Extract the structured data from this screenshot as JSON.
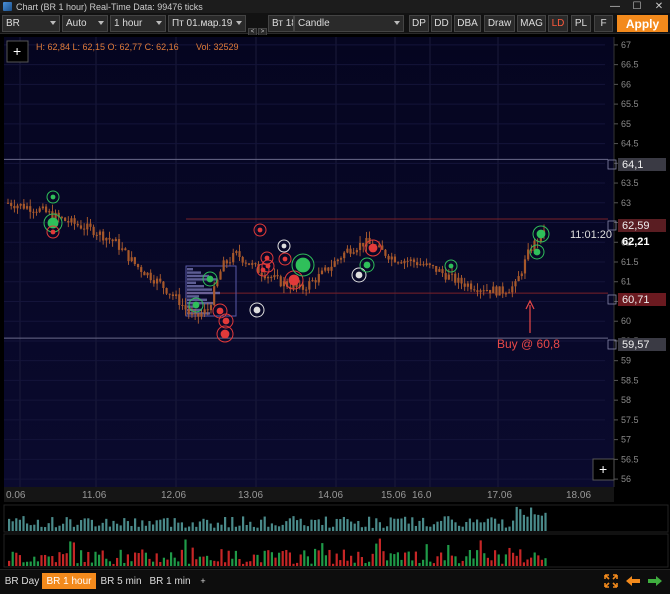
{
  "window": {
    "title": "Chart (BR 1 hour) Real-Time Data: 99476 ticks",
    "minimize": "—",
    "maximize": "☐",
    "close": "✕"
  },
  "toolbar": {
    "symbol": "BR",
    "scale": "Auto",
    "timeframe": "1 hour",
    "date_from": "Пт 01.мар.19",
    "date_to": "Вт 18",
    "chart_type": "Candle",
    "step_left": "<",
    "step_right": ">",
    "buttons": [
      "DP",
      "DD",
      "DBA",
      "Draw",
      "MAG",
      "LD",
      "PL",
      "F"
    ],
    "active_button": "LD",
    "apply_label": "Apply"
  },
  "info": {
    "ohlc": "H: 62,84  L: 62,15  O: 62,77  C: 62,16",
    "volume": "Vol: 32529",
    "zoom_in": "+"
  },
  "price_labels": {
    "level_high": "64,1",
    "last_price": "62,59",
    "countdown": "11:01:20",
    "bid": "62,21",
    "entry_level": "60,71",
    "level_low": "59,57"
  },
  "annotation": "Buy @ 60,8",
  "chart_data": {
    "type": "candlestick",
    "symbol": "BR",
    "timeframe": "1 hour",
    "y_ticks": [
      "67",
      "66.5",
      "66",
      "65.5",
      "65",
      "64.5",
      "64",
      "63.5",
      "63",
      "62.5",
      "62",
      "61.5",
      "61",
      "60.5",
      "60",
      "59.5",
      "59",
      "58.5",
      "58",
      "57.5",
      "57",
      "56.5",
      "56"
    ],
    "ylim": [
      55.8,
      67.2
    ],
    "x_ticks": [
      "0.06",
      "11.06",
      "12.06",
      "13.06",
      "14.06",
      "15.06",
      "16.0",
      "17.06",
      "18.06"
    ],
    "horizontal_levels": [
      64.1,
      62.59,
      60.71,
      59.57
    ],
    "close_path": [
      {
        "t": 0,
        "p": 63.0
      },
      {
        "t": 0.08,
        "p": 62.85
      },
      {
        "t": 0.16,
        "p": 62.55
      },
      {
        "t": 0.24,
        "p": 62.3
      },
      {
        "t": 0.3,
        "p": 62.0
      },
      {
        "t": 0.36,
        "p": 61.4
      },
      {
        "t": 0.42,
        "p": 61.0
      },
      {
        "t": 0.48,
        "p": 60.5
      },
      {
        "t": 0.52,
        "p": 60.05
      },
      {
        "t": 0.56,
        "p": 60.3
      },
      {
        "t": 0.6,
        "p": 61.4
      },
      {
        "t": 0.64,
        "p": 61.7
      },
      {
        "t": 0.7,
        "p": 61.3
      },
      {
        "t": 0.76,
        "p": 61.0
      },
      {
        "t": 0.82,
        "p": 60.8
      },
      {
        "t": 0.88,
        "p": 61.2
      },
      {
        "t": 0.95,
        "p": 61.8
      },
      {
        "t": 1.0,
        "p": 62.0
      },
      {
        "t": 1.08,
        "p": 61.6
      },
      {
        "t": 1.14,
        "p": 61.5
      },
      {
        "t": 1.2,
        "p": 61.3
      },
      {
        "t": 1.26,
        "p": 61.0
      },
      {
        "t": 1.32,
        "p": 60.85
      },
      {
        "t": 1.38,
        "p": 60.75
      },
      {
        "t": 1.42,
        "p": 60.9
      },
      {
        "t": 1.46,
        "p": 61.8
      },
      {
        "t": 1.5,
        "p": 62.3
      }
    ]
  },
  "bottom_tabs": [
    "BR Day",
    "BR 1 hour",
    "BR 5 min",
    "BR 1 min",
    "+"
  ],
  "active_tab": "BR 1 hour",
  "colors": {
    "accent": "#f38a1c",
    "up": "#1e9f75",
    "down": "#d8292f",
    "candle": "#a7582a",
    "plot_bg": "#04041a"
  }
}
